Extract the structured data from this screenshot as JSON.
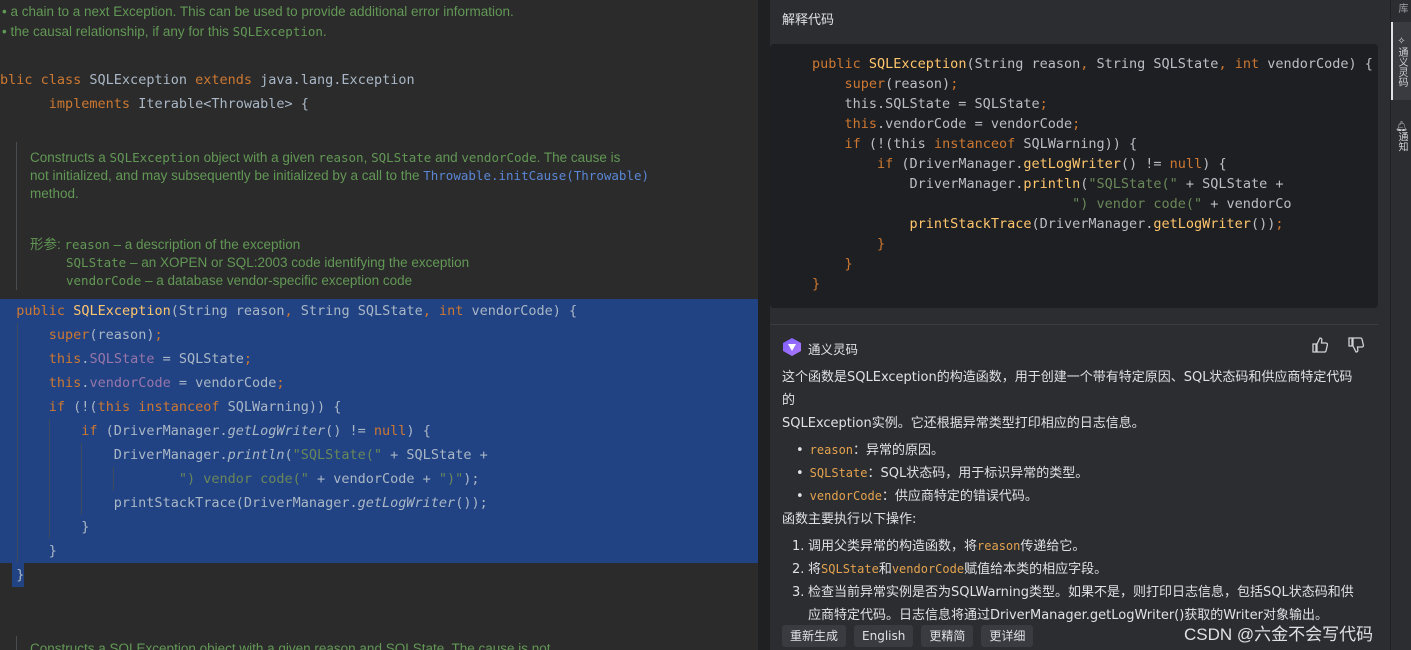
{
  "editor": {
    "doc_top": {
      "line1": "• a chain to a next Exception. This can be used to provide additional error information.",
      "line2_pre": "• the causal relationship, if any for this ",
      "line2_code": "SQLException",
      "line2_post": "."
    },
    "class_decl": {
      "kw1": "blic class",
      "name": "SQLException",
      "kw2": "extends",
      "parent": "java.lang.Exception",
      "kw3": "implements",
      "iface": "Iterable<Throwable> {"
    },
    "javadoc": {
      "l1_a": "Constructs a ",
      "l1_b": "SQLException",
      "l1_c": " object with a given ",
      "l1_d": "reason",
      "l1_e": ", ",
      "l1_f": "SQLState",
      "l1_g": " and ",
      "l1_h": "vendorCode",
      "l1_i": ". The cause is",
      "l2_a": "not initialized, and may subsequently be initialized by a call to the ",
      "l2_link": "Throwable.initCause(Throwable)",
      "l3": "method.",
      "params_label": "形参:",
      "p1_name": "reason",
      "p1_desc": " – a description of the exception",
      "p2_name": "SQLState",
      "p2_desc": " – an XOPEN or SQL:2003 code identifying the exception",
      "p3_name": "vendorCode",
      "p3_desc": " – a database vendor-specific exception code"
    },
    "code": {
      "public": "public",
      "ctor": "SQLException",
      "sig1": "(String reason",
      "comma": ",",
      "sig2": " String SQLState",
      "int": "int",
      "sig3": " vendorCode) {",
      "super": "super",
      "super_args": "(reason)",
      "semi": ";",
      "this": "this",
      "f_sqlstate": "SQLState",
      "assign_sqlstate": " = SQLState",
      "f_vendor": "vendorCode",
      "assign_vendor": " = vendorCode",
      "if": "if",
      "cond1": " (!(",
      "instanceof": "instanceof",
      "cond1b": " SQLWarning)) {",
      "cond2a": " (DriverManager.",
      "getLogWriter": "getLogWriter",
      "cond2b": "() != ",
      "null": "null",
      "cond2c": ") {",
      "dm": "DriverManager.",
      "println": "println",
      "p_open": "(",
      "s1": "\"SQLState(\"",
      "plus1": " + SQLState +",
      "s2": "\") vendor code(\"",
      "plus2": " + vendorCode + ",
      "s3": "\")\"",
      "p_close": ");",
      "pst": "printStackTrace",
      "pst_args1": "(DriverManager.",
      "pst_args2": "());",
      "brace": "}"
    },
    "doc_bottom": "Constructs a SQLException object with a given reason and SQLState. The cause is not"
  },
  "panel": {
    "title": "解释代码",
    "codecard_lines": [
      {
        "indent": "",
        "parts": [
          [
            "kw",
            "public"
          ],
          [
            "fn",
            " SQLException"
          ],
          [
            "",
            "(String reason"
          ],
          [
            "kw",
            ","
          ],
          [
            "",
            " String SQLState"
          ],
          [
            "kw",
            ","
          ],
          [
            "kw",
            " int"
          ],
          [
            "",
            " vendorCode) {"
          ]
        ]
      },
      {
        "indent": "    ",
        "parts": [
          [
            "kw",
            "super"
          ],
          [
            "",
            "(reason)"
          ],
          [
            "kw",
            ";"
          ]
        ]
      },
      {
        "indent": "    ",
        "parts": [
          [
            "",
            "this.SQLState = SQLState"
          ],
          [
            "kw",
            ";"
          ]
        ]
      },
      {
        "indent": "    ",
        "parts": [
          [
            "kw",
            "this"
          ],
          [
            "",
            ".vendorCode = vendorCode"
          ],
          [
            "kw",
            ";"
          ]
        ]
      },
      {
        "indent": "    ",
        "parts": [
          [
            "kw",
            "if"
          ],
          [
            "",
            " (!(this "
          ],
          [
            "kw",
            "instanceof"
          ],
          [
            "",
            " SQLWarning)) {"
          ]
        ]
      },
      {
        "indent": "        ",
        "parts": [
          [
            "kw",
            "if"
          ],
          [
            "",
            " (DriverManager."
          ],
          [
            "fn",
            "getLogWriter"
          ],
          [
            "",
            "() != "
          ],
          [
            "kw",
            "null"
          ],
          [
            "",
            ") {"
          ]
        ]
      },
      {
        "indent": "            ",
        "parts": [
          [
            "",
            "DriverManager."
          ],
          [
            "fn",
            "println"
          ],
          [
            "",
            "("
          ],
          [
            "str",
            "\"SQLState(\""
          ],
          [
            "",
            " + SQLState +"
          ]
        ]
      },
      {
        "indent": "                                ",
        "parts": [
          [
            "str",
            "\") vendor code(\""
          ],
          [
            "",
            " + vendorCo"
          ]
        ]
      },
      {
        "indent": "            ",
        "parts": [
          [
            "fn",
            "printStackTrace"
          ],
          [
            "",
            "(DriverManager."
          ],
          [
            "fn",
            "getLogWriter"
          ],
          [
            "",
            "())"
          ],
          [
            "kw",
            ";"
          ]
        ]
      },
      {
        "indent": "        ",
        "parts": [
          [
            "kw",
            "}"
          ]
        ]
      },
      {
        "indent": "    ",
        "parts": [
          [
            "kw",
            "}"
          ]
        ]
      },
      {
        "indent": "",
        "parts": [
          [
            "kw",
            "}"
          ]
        ]
      }
    ],
    "ai": {
      "name": "通义灵码",
      "intro1": "这个函数是SQLException的构造函数，用于创建一个带有特定原因、SQL状态码和供应商特定代码的",
      "intro2": "SQLException实例。它还根据异常类型打印相应的日志信息。",
      "params": [
        {
          "code": "reason",
          "text": "：异常的原因。"
        },
        {
          "code": "SQLState",
          "text": "：SQL状态码，用于标识异常的类型。"
        },
        {
          "code": "vendorCode",
          "text": "：供应商特定的错误代码。"
        }
      ],
      "ops_title": "函数主要执行以下操作:",
      "ops": {
        "o1_num": "1.",
        "o1_a": "调用父类异常的构造函数，将",
        "o1_code": "reason",
        "o1_b": "传递给它。",
        "o2_num": "2.",
        "o2_a": "将",
        "o2_code1": "SQLState",
        "o2_b": "和",
        "o2_code2": "vendorCode",
        "o2_c": "赋值给本类的相应字段。",
        "o3_num": "3.",
        "o3_a": "检查当前异常实例是否为SQLWarning类型。如果不是，则打印日志信息，包括SQL状态码和供",
        "o3_b": "应商特定代码。日志信息将通过DriverManager.getLogWriter()获取的Writer对象输出。"
      }
    },
    "footer": {
      "regen": "重新生成",
      "english": "English",
      "simpler": "更精简",
      "detailed": "更详细"
    }
  },
  "strip": {
    "tab1": "库",
    "tab2": "通义灵码",
    "tab3": "通知"
  },
  "watermark": "CSDN @六金不会写代码",
  "colors": {
    "editor_bg": "#2b2b2b",
    "selection": "#214283",
    "keyword": "#cc7832",
    "function": "#ffc66d",
    "field": "#9876aa",
    "string": "#6a8759",
    "doc": "#629755"
  }
}
